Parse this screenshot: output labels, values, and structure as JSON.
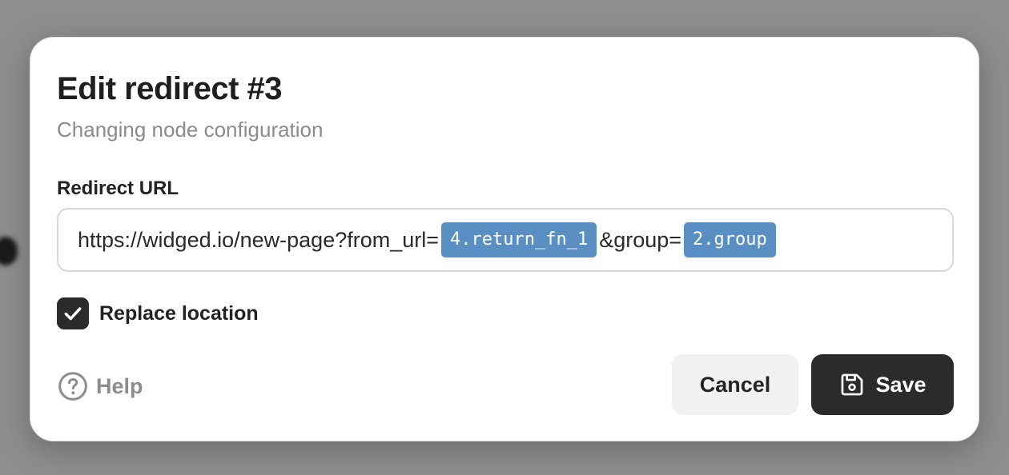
{
  "dialog": {
    "title": "Edit redirect #3",
    "subtitle": "Changing node configuration"
  },
  "redirect_url": {
    "label": "Redirect URL",
    "parts": [
      {
        "type": "text",
        "value": "https://widged.io/new-page?from_url="
      },
      {
        "type": "token",
        "value": "4.return_fn_1"
      },
      {
        "type": "text",
        "value": "&group="
      },
      {
        "type": "token",
        "value": "2.group"
      }
    ]
  },
  "replace_location": {
    "label": "Replace location",
    "checked": true
  },
  "footer": {
    "help_label": "Help",
    "help_icon": "question-circle-icon",
    "cancel_label": "Cancel",
    "save_label": "Save",
    "save_icon": "floppy-disk-icon"
  },
  "colors": {
    "token_bg": "#5a8fc4",
    "primary_button": "#2b2b2b",
    "checkbox": "#2b2b2b"
  }
}
